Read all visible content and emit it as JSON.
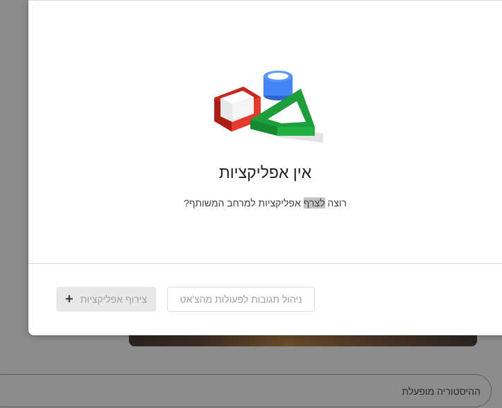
{
  "background": {
    "history_status": "ההיסטוריה מופעלת"
  },
  "modal": {
    "title": "אין אפליקציות",
    "subtitle_before": "רוצה ",
    "subtitle_highlight": "לצרף",
    "subtitle_after": " אפליקציות למרחב המשותף?",
    "manage_button_label": "ניהול תגובות לפעולות מהצ'אט",
    "add_apps_button_label": "צירוף אפליקציות",
    "add_icon": "plus-icon",
    "illustration": "shapes-illustration"
  },
  "colors": {
    "red_shape": "#e53b2f",
    "blue_shape": "#4285f4",
    "green_shape": "#1e9e3a",
    "disabled_text": "#9aa0a6"
  }
}
